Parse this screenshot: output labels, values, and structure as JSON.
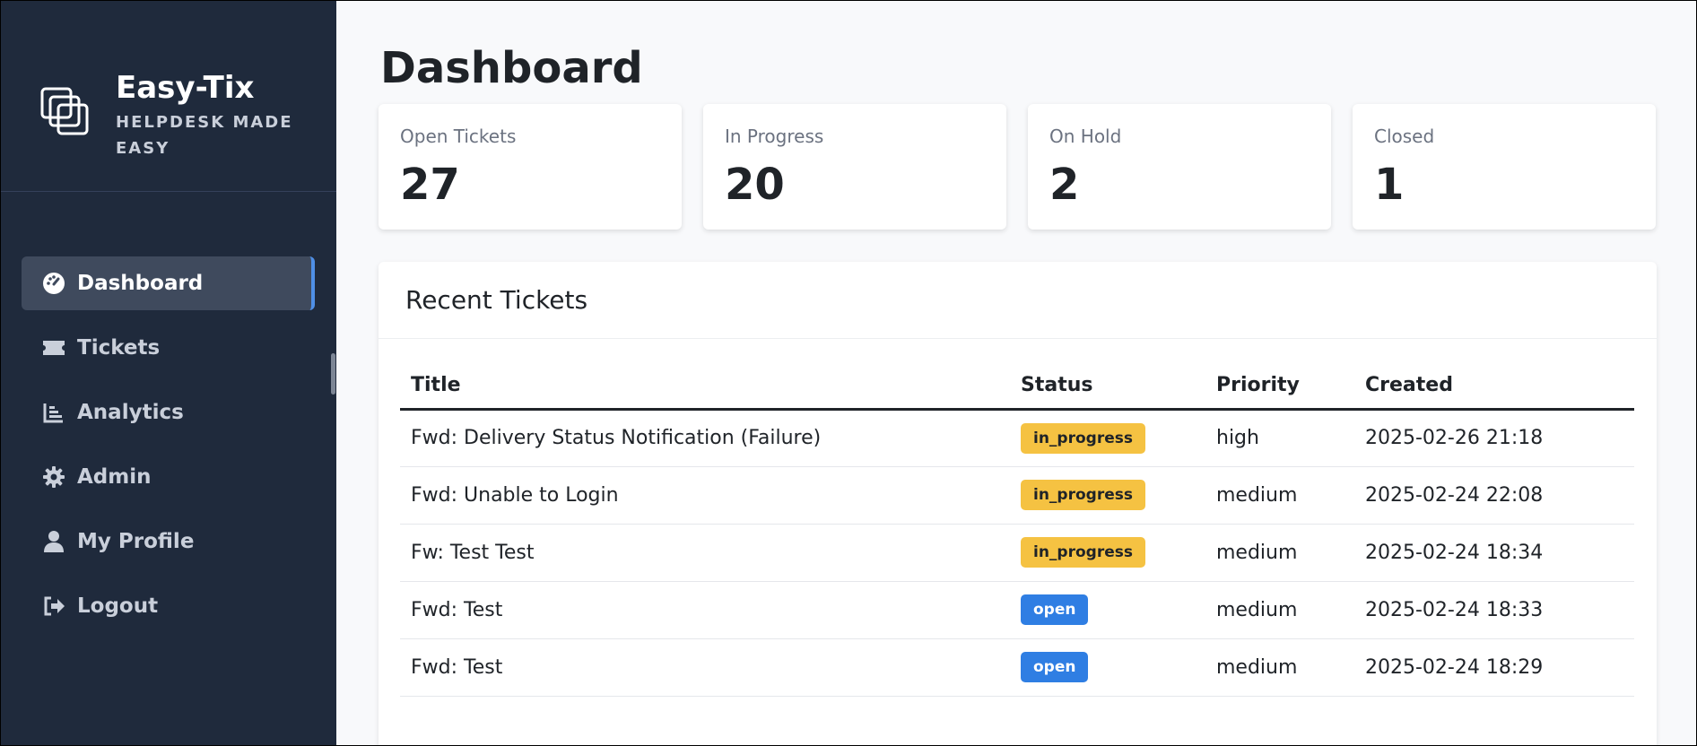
{
  "brand": {
    "name": "Easy-Tix",
    "tagline": "HELPDESK MADE EASY"
  },
  "sidebar": {
    "items": [
      {
        "label": "Dashboard",
        "icon": "dashboard-gauge-icon",
        "active": true
      },
      {
        "label": "Tickets",
        "icon": "ticket-icon",
        "active": false
      },
      {
        "label": "Analytics",
        "icon": "bar-chart-icon",
        "active": false
      },
      {
        "label": "Admin",
        "icon": "gear-icon",
        "active": false
      },
      {
        "label": "My Profile",
        "icon": "user-icon",
        "active": false
      },
      {
        "label": "Logout",
        "icon": "logout-icon",
        "active": false
      }
    ]
  },
  "page": {
    "title": "Dashboard"
  },
  "stats": [
    {
      "label": "Open Tickets",
      "value": "27"
    },
    {
      "label": "In Progress",
      "value": "20"
    },
    {
      "label": "On Hold",
      "value": "2"
    },
    {
      "label": "Closed",
      "value": "1"
    }
  ],
  "recent": {
    "title": "Recent Tickets",
    "columns": [
      "Title",
      "Status",
      "Priority",
      "Created"
    ],
    "rows": [
      {
        "title": "Fwd: Delivery Status Notification (Failure)",
        "status": "in_progress",
        "priority": "high",
        "created": "2025-02-26 21:18"
      },
      {
        "title": "Fwd: Unable to Login",
        "status": "in_progress",
        "priority": "medium",
        "created": "2025-02-24 22:08"
      },
      {
        "title": "Fw: Test Test",
        "status": "in_progress",
        "priority": "medium",
        "created": "2025-02-24 18:34"
      },
      {
        "title": "Fwd: Test",
        "status": "open",
        "priority": "medium",
        "created": "2025-02-24 18:33"
      },
      {
        "title": "Fwd: Test",
        "status": "open",
        "priority": "medium",
        "created": "2025-02-24 18:29"
      }
    ]
  },
  "colors": {
    "sidebar_bg": "#1f2a3c",
    "active_accent": "#4f8fe6",
    "badge_in_progress": "#f5c242",
    "badge_open": "#2f7ee3"
  }
}
